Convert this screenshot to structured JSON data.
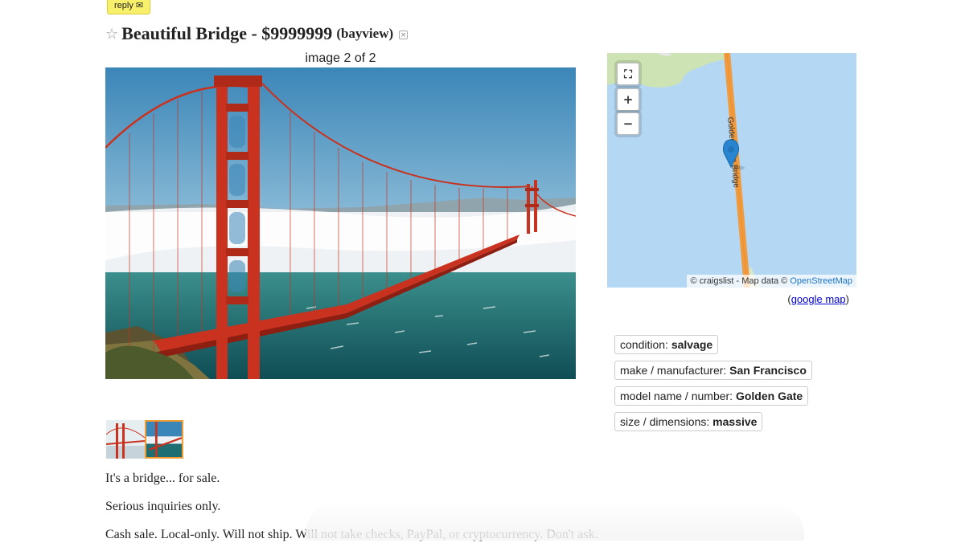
{
  "posting": {
    "reply_label": "reply",
    "reply_icon": "✉",
    "star_icon": "☆",
    "title": "Beautiful Bridge - $9999999",
    "location": "(bayview)",
    "hide_icon": "⊠"
  },
  "gallery": {
    "counter": "image 2 of 2",
    "selected_index": 2,
    "thumbnail_count": 2
  },
  "body": {
    "paragraphs": [
      "It's a bridge... for sale.",
      "Serious inquiries only.",
      "Cash sale. Local-only. Will not ship. Will not take checks, PayPal, or cryptocurrency. Don't ask."
    ]
  },
  "map": {
    "fullscreen_icon": "fullscreen-icon",
    "zoom_in": "+",
    "zoom_out": "−",
    "road_label": "Golden Gate Bridge",
    "attribution_prefix": "© craigslist - Map data © ",
    "attribution_link": "OpenStreetMap",
    "google_prefix": "(",
    "google_link": "google map",
    "google_suffix": ")",
    "colors": {
      "water": "#b4d8f3",
      "land": "#cde3b4",
      "road": "#f19a3e",
      "pin": "#2a85d0"
    }
  },
  "attributes": [
    {
      "label": "condition: ",
      "value": "salvage"
    },
    {
      "label": "make / manufacturer: ",
      "value": "San Francisco"
    },
    {
      "label": "model name / number: ",
      "value": "Golden Gate"
    },
    {
      "label": "size / dimensions: ",
      "value": "massive"
    }
  ]
}
